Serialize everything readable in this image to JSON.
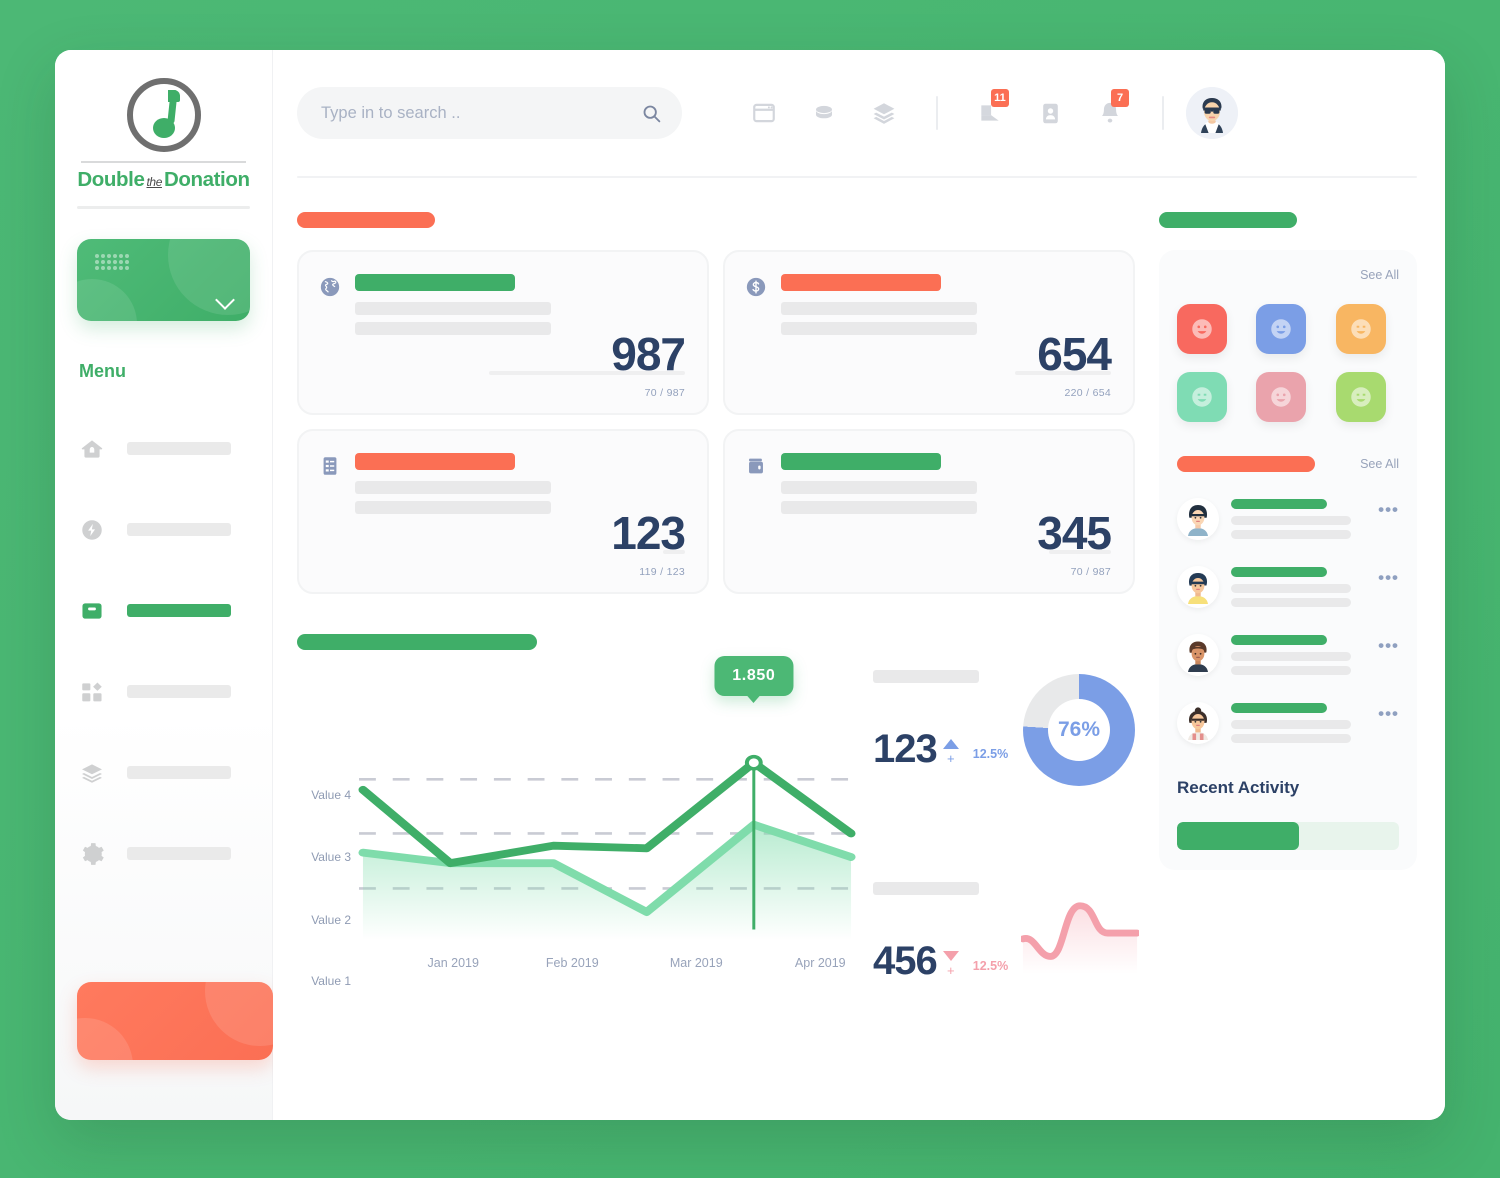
{
  "brand": {
    "name_part1": "Double",
    "name_the": "the",
    "name_part2": "Donation",
    "logo_icon": "music-note-circle-logo"
  },
  "sidebar": {
    "org_selector": {
      "icon": "grid-dots-icon",
      "chevron": "chevron-down-icon"
    },
    "menu_heading": "Menu",
    "items": [
      {
        "icon": "home-icon",
        "label": "",
        "active": false
      },
      {
        "icon": "flash-icon",
        "label": "",
        "active": false
      },
      {
        "icon": "inbox-icon",
        "label": "",
        "active": true
      },
      {
        "icon": "dashboard-grid-icon",
        "label": "",
        "active": false
      },
      {
        "icon": "layers-icon",
        "label": "",
        "active": false
      },
      {
        "icon": "gear-icon",
        "label": "",
        "active": false
      }
    ],
    "cta_label": ""
  },
  "topbar": {
    "search": {
      "value": "",
      "placeholder": "Type in to search ..",
      "icon": "search-icon"
    },
    "icons": [
      {
        "name": "browser-window-icon",
        "badge": ""
      },
      {
        "name": "coins-icon",
        "badge": ""
      },
      {
        "name": "layers-icon",
        "badge": ""
      },
      {
        "name": "mail-icon",
        "badge": "11"
      },
      {
        "name": "contact-card-icon",
        "badge": ""
      },
      {
        "name": "bell-icon",
        "badge": "7"
      }
    ],
    "avatar": "user-avatar-glasses"
  },
  "main": {
    "section_title_left": "",
    "section_title_right": "",
    "stat_cards": [
      {
        "icon": "globe-icon",
        "title_color": "#3fae68",
        "value": "987",
        "ratio": "70 / 987",
        "progress": 7
      },
      {
        "icon": "dollar-icon",
        "title_color": "#fb6f54",
        "value": "654",
        "ratio": "220 / 654",
        "progress": 34
      },
      {
        "icon": "list-icon",
        "title_color": "#fb6f54",
        "value": "123",
        "ratio": "119 / 123",
        "progress": 97
      },
      {
        "icon": "wallet-icon",
        "title_color": "#3fae68",
        "value": "345",
        "ratio": "70 / 987",
        "progress": 7
      }
    ],
    "chart_section_title": "",
    "kpis": [
      {
        "label": "",
        "value": "123",
        "trend": "up",
        "trend_symbol": "▲",
        "plus": "+",
        "percent": "12.5%",
        "visual": "donut",
        "donut_value": "76%",
        "donut_percent": 76,
        "color": "#7b9ee6"
      },
      {
        "label": "",
        "value": "456",
        "trend": "down",
        "trend_symbol": "▼",
        "plus": "+",
        "percent": "12.5%",
        "visual": "sparkline",
        "color": "#f4a0ab"
      }
    ]
  },
  "chart_data": {
    "type": "line",
    "title": "",
    "xlabel": "",
    "ylabel": "",
    "x": [
      "Jan 2019",
      "Feb 2019",
      "Mar 2019",
      "Apr 2019"
    ],
    "ytick_labels": [
      "Value 1",
      "Value 2",
      "Value 3",
      "Value 4"
    ],
    "ylim": [
      1,
      4.6
    ],
    "grid": true,
    "grid_lines_at": [
      "Value 2",
      "Value 3",
      "Value 4"
    ],
    "legend": "none",
    "series": [
      {
        "name": "Series 1",
        "color": "#3fae68",
        "filled": false,
        "values": [
          3.85,
          2.52,
          2.8,
          2.78,
          4.4,
          2.95
        ]
      },
      {
        "name": "Series 2",
        "color": "#7fdcab",
        "filled": true,
        "values": [
          2.72,
          2.55,
          2.58,
          1.62,
          3.4,
          2.9
        ]
      }
    ],
    "annotations": [
      {
        "label": "1.850",
        "series": "Series 1",
        "point_index": 4,
        "marker": true
      }
    ]
  },
  "right_panel": {
    "people_card": {
      "see_all": "See All",
      "tiles": [
        {
          "color": "#f8695f",
          "icon": "smiley-icon"
        },
        {
          "color": "#7b9ee6",
          "icon": "smiley-icon"
        },
        {
          "color": "#f8b662",
          "icon": "smiley-icon"
        },
        {
          "color": "#7fdcb4",
          "icon": "smiley-icon"
        },
        {
          "color": "#eaa3ac",
          "icon": "smiley-icon"
        },
        {
          "color": "#a8da6f",
          "icon": "smiley-icon"
        }
      ]
    },
    "activity_list": {
      "title_color": "#fb6f54",
      "see_all": "See All",
      "rows": [
        {
          "avatar": "woman-dark-hair",
          "more": "•••"
        },
        {
          "avatar": "woman-yellow-top",
          "more": "•••"
        },
        {
          "avatar": "man-brown-hair",
          "more": "•••"
        },
        {
          "avatar": "woman-bun",
          "more": "•••"
        }
      ]
    },
    "recent_activity": {
      "title": "Recent Activity",
      "progress_percent": 55
    }
  }
}
